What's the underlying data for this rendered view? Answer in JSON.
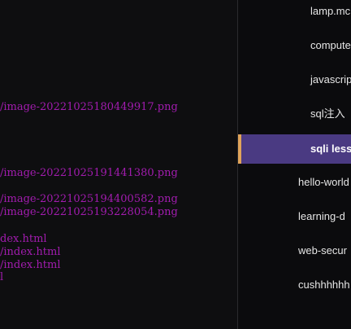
{
  "editor": {
    "lines": [
      "/image-20221025180449917.png",
      "/image-20221025191441380.png",
      "/image-20221025194400582.png",
      "/image-20221025193228054.png",
      "dex.html",
      "/index.html",
      "/index.html",
      "l"
    ]
  },
  "sidebar": {
    "items": [
      {
        "label": "lamp.mc",
        "level": "sub"
      },
      {
        "label": "compute",
        "level": "sub"
      },
      {
        "label": "javascrip",
        "level": "sub"
      },
      {
        "label": "sql注入",
        "level": "sub"
      },
      {
        "label": "sqli less",
        "level": "sub",
        "active": true
      },
      {
        "label": "hello-world",
        "level": "top"
      },
      {
        "label": "learning-d",
        "level": "top"
      },
      {
        "label": "web-secur",
        "level": "top"
      },
      {
        "label": "cushhhhhh",
        "level": "top"
      }
    ]
  },
  "colors": {
    "background": "#0d0d0f",
    "code_text": "#a21caf",
    "active_bg": "#4a3a82",
    "active_marker": "#e0a45a"
  }
}
